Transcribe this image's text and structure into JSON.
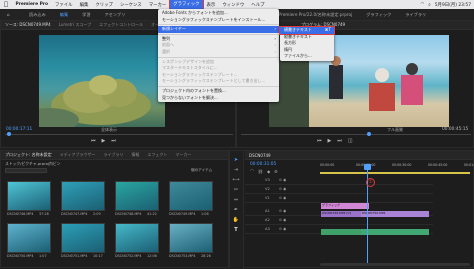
{
  "menubar": {
    "apple": "",
    "app": "Premiere Pro",
    "items": [
      "ファイル",
      "編集",
      "クリップ",
      "シーケンス",
      "マーカー",
      "グラフィック",
      "表示",
      "ウィンドウ",
      "ヘルプ"
    ],
    "active_index": 5,
    "clock": "5月9日(月) 23:57"
  },
  "workspaces": [
    "ホーム",
    "読み込み",
    "編集",
    "学習",
    "アセンブリ",
    "編集",
    "カラー",
    "エフェクト",
    "オーディオ",
    "グラフィック",
    "ライブラリ"
  ],
  "window_title": "/ユーザー/Premiere Pro/22.0/名称未設定.prproj",
  "source_panel": {
    "tabs": [
      "ソース: DSCN0749.MP4",
      "Lumetri スコープ",
      "エフェクトコントロール",
      "オーディオクリップミキサー:"
    ],
    "timecode": "00:00:17:11",
    "fit": "全体表示"
  },
  "program_panel": {
    "tabs": [
      "プログラム: DSCN0749"
    ],
    "timecode_end": "00:00:45:15",
    "quality": "フル画質"
  },
  "graphics_menu": {
    "items": [
      {
        "label": "Adobe Fonts からフォントを追加...",
        "dis": false
      },
      {
        "label": "モーショングラフィックステンプレートをインストール...",
        "dis": false
      },
      {
        "sep": true
      },
      {
        "label": "新規レイヤー",
        "dis": false,
        "arrow": true,
        "hl": true
      },
      {
        "sep": true
      },
      {
        "label": "整列",
        "dis": false,
        "arrow": true
      },
      {
        "label": "前面へ",
        "dis": true,
        "arrow": true
      },
      {
        "label": "選択",
        "dis": true,
        "arrow": true
      },
      {
        "sep": true
      },
      {
        "label": "レスポンシブデザインを追加",
        "dis": true
      },
      {
        "label": "マスターテキストスタイルに...",
        "dis": true
      },
      {
        "label": "モーショングラフィックステンプレート...",
        "dis": true
      },
      {
        "label": "モーショングラフィックステンプレートとして書き出し...",
        "dis": true
      },
      {
        "sep": true
      },
      {
        "label": "プロジェクト内のフォントを置換...",
        "dis": false
      },
      {
        "label": "見つからないフォントを解決...",
        "dis": false
      }
    ]
  },
  "newlayer_menu": {
    "items": [
      {
        "label": "横書きテキスト",
        "shortcut": "⌘T",
        "hl": true
      },
      {
        "label": "縦書きテキスト",
        "shortcut": "",
        "hl": false
      },
      {
        "label": "長方形",
        "shortcut": "",
        "hl": false
      },
      {
        "label": "楕円",
        "shortcut": "",
        "hl": false
      },
      {
        "label": "ファイルから...",
        "shortcut": "",
        "hl": false
      }
    ]
  },
  "project_panel": {
    "tabs": [
      "プロジェクト: 名称未設定",
      "メディアブラウザー",
      "ライブラリ",
      "情報",
      "エフェクト",
      "マーカー"
    ],
    "path": "ストック/ピクチャ.prproj内ビン",
    "count": "個のアイテム",
    "items": [
      {
        "name": "DSCN0746.MP4",
        "dur": "37:28",
        "color": "#4fc5d6"
      },
      {
        "name": "DSCN0747.MP4",
        "dur": "2:09",
        "color": "#2fa0b8"
      },
      {
        "name": "DSCN0748.MP4",
        "dur": "41:22",
        "color": "#2aa6a0"
      },
      {
        "name": "DSCN0749.MP4",
        "dur": "1:06",
        "color": "#3e8a9a"
      },
      {
        "name": "DSCN0750.MP4",
        "dur": "1:07",
        "color": "#5fb3cf"
      },
      {
        "name": "DSCN0751.MP4",
        "dur": "10:17",
        "color": "#2c9fb7"
      },
      {
        "name": "DSCN0752.MP4",
        "dur": "12:06",
        "color": "#45b8c9"
      },
      {
        "name": "DSCN0753.MP4",
        "dur": "28:26",
        "color": "#6ab0c4"
      }
    ]
  },
  "timeline": {
    "tab": "DSCN0749",
    "timecode": "00:00:31:05",
    "ruler": [
      "00:00:00",
      "00:00:15:00",
      "00:00:30:00",
      "00:00:45:00",
      "00:01:00:00"
    ],
    "tracks": [
      "V3",
      "V2",
      "V1",
      "A1",
      "A2",
      "A3"
    ],
    "clip_graphic": "グラフィック",
    "clip_v1": "DSCN0749.MP4 [V]",
    "clip_v1b": "DSCN0750.MP4",
    "callout": "①"
  }
}
